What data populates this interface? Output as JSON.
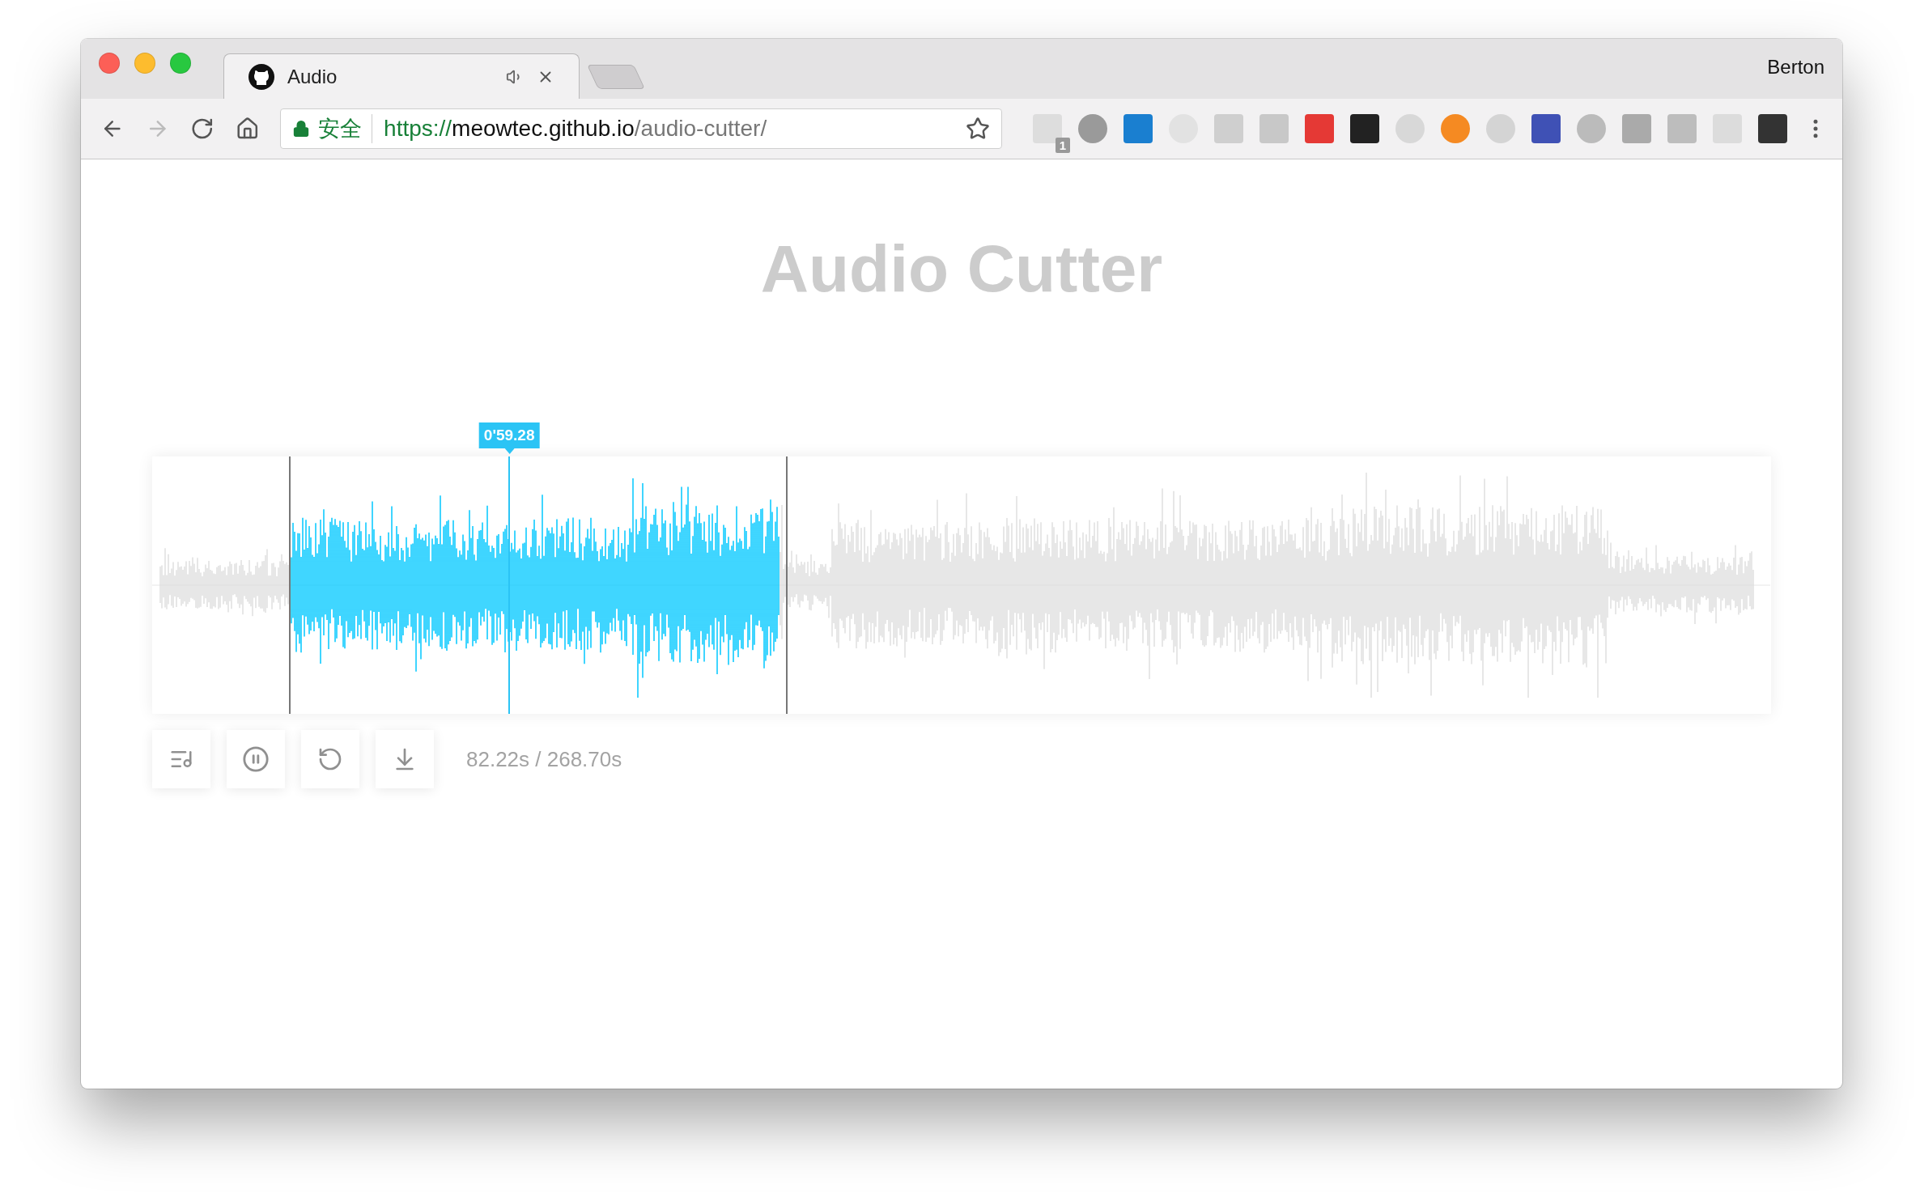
{
  "browser": {
    "tabs": [
      {
        "title": "Audio",
        "audible": true,
        "selected": true
      }
    ],
    "profile": "Berton",
    "address": {
      "secure_label": "安全",
      "scheme": "https://",
      "host": "meowtec.github.io",
      "path": "/audio-cutter/"
    },
    "extension_badge": "1"
  },
  "page": {
    "title": "Audio Cutter",
    "waveform": {
      "playhead": {
        "label": "0'59.28",
        "level": 0.2206
      },
      "handles": [
        {
          "level": 0.085
        },
        {
          "level": 0.392
        }
      ]
    },
    "player": {
      "playing": true,
      "time": "82.22s / 268.70s"
    }
  }
}
